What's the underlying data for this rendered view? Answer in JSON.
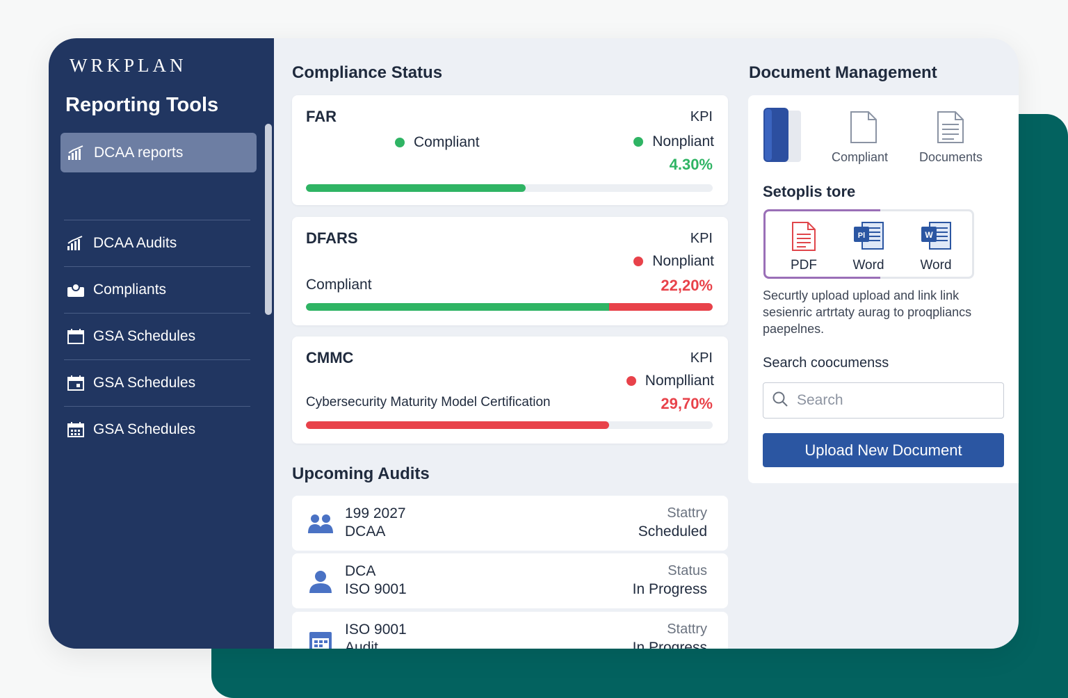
{
  "sidebar": {
    "brand": "WRKPLAN",
    "title": "Reporting Tools",
    "active_item": "DCAA reports",
    "items": [
      {
        "label": "DCAA Audits"
      },
      {
        "label": "Compliants"
      },
      {
        "label": "GSA Schedules"
      },
      {
        "label": "GSA Schedules"
      },
      {
        "label": "GSA Schedules"
      }
    ]
  },
  "compliance": {
    "title": "Compliance Status",
    "cards": [
      {
        "name": "FAR",
        "kpi": "KPI",
        "legend_left": "Compliant",
        "legend_right": "Nonpliant",
        "percent": "4.30%",
        "progress_green": 0.54,
        "progress_red": 0
      },
      {
        "name": "DFARS",
        "kpi": "KPI",
        "legend_right": "Nonpliant",
        "label": "Compliant",
        "percent": "22,20%",
        "progress_green": 0.745,
        "progress_red": 0.255
      },
      {
        "name": "CMMC",
        "kpi": "KPI",
        "legend_right": "Nomplliant",
        "label": "Cybersecurity Maturity Model Certification",
        "percent": "29,70%",
        "progress_green": 0,
        "progress_red": 0.745
      }
    ]
  },
  "audits": {
    "title": "Upcoming Audits",
    "rows": [
      {
        "line1": "199 2027",
        "line2": "DCAA",
        "status_label": "Stattry",
        "status": "Scheduled"
      },
      {
        "line1": "DCA",
        "line2": "ISO 9001",
        "status_label": "Status",
        "status": "In Progress"
      },
      {
        "line1": "ISO 9001",
        "line2": "Audit",
        "status_label": "Stattry",
        "status": "In Progress"
      }
    ]
  },
  "documents": {
    "title": "Document Management",
    "icon_labels": [
      "Compliant",
      "Documents"
    ],
    "subheading": "Setoplis tore",
    "types": [
      {
        "label": "PDF"
      },
      {
        "label": "Word"
      },
      {
        "label": "Word"
      }
    ],
    "description": "Securtly upload upload and link link sesienric artrtaty aurag to proqpliancs paepelnes.",
    "search_label": "Search coocumenss",
    "search_placeholder": "Search",
    "upload_button": "Upload New Document"
  },
  "colors": {
    "sidebar": "#213661",
    "accent_green": "#2fb464",
    "accent_red": "#e8424a",
    "button_blue": "#2b56a2",
    "teal": "#03625f"
  }
}
